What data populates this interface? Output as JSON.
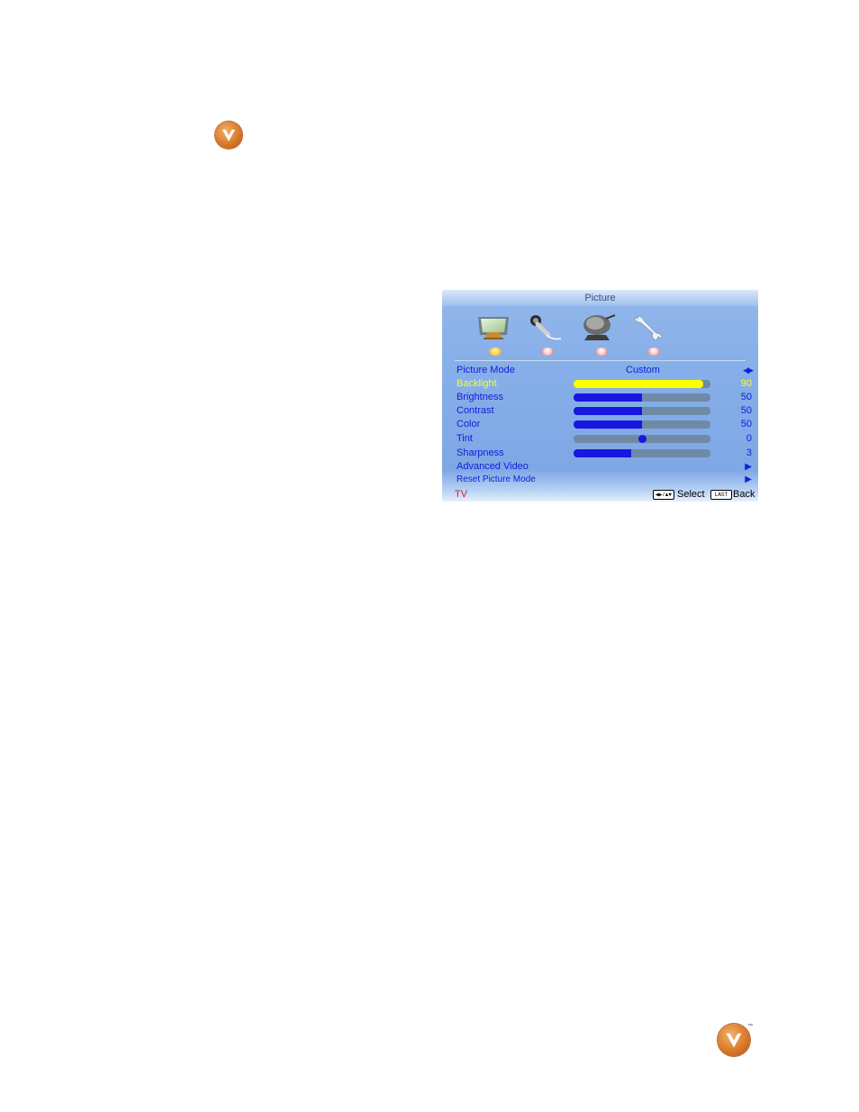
{
  "osd": {
    "title": "Picture",
    "tabs": [
      {
        "icon": "picture-tab-icon"
      },
      {
        "icon": "audio-tab-icon"
      },
      {
        "icon": "tv-tab-icon"
      },
      {
        "icon": "settings-tab-icon"
      }
    ],
    "menu": {
      "picture_mode": {
        "label": "Picture Mode",
        "value": "Custom"
      },
      "backlight": {
        "label": "Backlight",
        "value": "90",
        "level": 0.95
      },
      "brightness": {
        "label": "Brightness",
        "value": "50",
        "level": 0.5
      },
      "contrast": {
        "label": "Contrast",
        "value": "50",
        "level": 0.5
      },
      "color": {
        "label": "Color",
        "value": "50",
        "level": 0.5
      },
      "tint": {
        "label": "Tint",
        "value": "0",
        "level": 0.5
      },
      "sharpness": {
        "label": "Sharpness",
        "value": "3",
        "level": 0.42
      },
      "advanced_video": {
        "label": "Advanced Video"
      },
      "reset_picture_mode": {
        "label": "Reset Picture Mode"
      }
    },
    "footer": {
      "source": "TV",
      "select_key": "◀▶/▲▼",
      "select_label": "Select",
      "back_key": "LAST",
      "back_label": "Back"
    }
  },
  "brand": {
    "trademark": "™"
  },
  "colors": {
    "item_text": "#1020d8",
    "selected_text": "#ffff20",
    "bar_fill": "#1717e0",
    "selected_bar_fill": "#ffff00",
    "source_text": "#e0202a",
    "logo_orange": "#d9792a"
  }
}
